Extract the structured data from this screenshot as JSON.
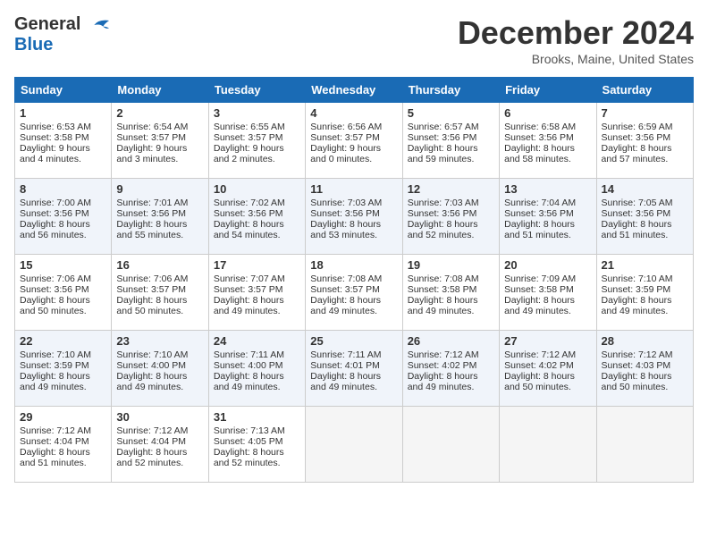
{
  "header": {
    "logo_line1": "General",
    "logo_line2": "Blue",
    "month": "December 2024",
    "location": "Brooks, Maine, United States"
  },
  "weekdays": [
    "Sunday",
    "Monday",
    "Tuesday",
    "Wednesday",
    "Thursday",
    "Friday",
    "Saturday"
  ],
  "weeks": [
    [
      {
        "day": 1,
        "lines": [
          "Sunrise: 6:53 AM",
          "Sunset: 3:58 PM",
          "Daylight: 9 hours",
          "and 4 minutes."
        ]
      },
      {
        "day": 2,
        "lines": [
          "Sunrise: 6:54 AM",
          "Sunset: 3:57 PM",
          "Daylight: 9 hours",
          "and 3 minutes."
        ]
      },
      {
        "day": 3,
        "lines": [
          "Sunrise: 6:55 AM",
          "Sunset: 3:57 PM",
          "Daylight: 9 hours",
          "and 2 minutes."
        ]
      },
      {
        "day": 4,
        "lines": [
          "Sunrise: 6:56 AM",
          "Sunset: 3:57 PM",
          "Daylight: 9 hours",
          "and 0 minutes."
        ]
      },
      {
        "day": 5,
        "lines": [
          "Sunrise: 6:57 AM",
          "Sunset: 3:56 PM",
          "Daylight: 8 hours",
          "and 59 minutes."
        ]
      },
      {
        "day": 6,
        "lines": [
          "Sunrise: 6:58 AM",
          "Sunset: 3:56 PM",
          "Daylight: 8 hours",
          "and 58 minutes."
        ]
      },
      {
        "day": 7,
        "lines": [
          "Sunrise: 6:59 AM",
          "Sunset: 3:56 PM",
          "Daylight: 8 hours",
          "and 57 minutes."
        ]
      }
    ],
    [
      {
        "day": 8,
        "lines": [
          "Sunrise: 7:00 AM",
          "Sunset: 3:56 PM",
          "Daylight: 8 hours",
          "and 56 minutes."
        ]
      },
      {
        "day": 9,
        "lines": [
          "Sunrise: 7:01 AM",
          "Sunset: 3:56 PM",
          "Daylight: 8 hours",
          "and 55 minutes."
        ]
      },
      {
        "day": 10,
        "lines": [
          "Sunrise: 7:02 AM",
          "Sunset: 3:56 PM",
          "Daylight: 8 hours",
          "and 54 minutes."
        ]
      },
      {
        "day": 11,
        "lines": [
          "Sunrise: 7:03 AM",
          "Sunset: 3:56 PM",
          "Daylight: 8 hours",
          "and 53 minutes."
        ]
      },
      {
        "day": 12,
        "lines": [
          "Sunrise: 7:03 AM",
          "Sunset: 3:56 PM",
          "Daylight: 8 hours",
          "and 52 minutes."
        ]
      },
      {
        "day": 13,
        "lines": [
          "Sunrise: 7:04 AM",
          "Sunset: 3:56 PM",
          "Daylight: 8 hours",
          "and 51 minutes."
        ]
      },
      {
        "day": 14,
        "lines": [
          "Sunrise: 7:05 AM",
          "Sunset: 3:56 PM",
          "Daylight: 8 hours",
          "and 51 minutes."
        ]
      }
    ],
    [
      {
        "day": 15,
        "lines": [
          "Sunrise: 7:06 AM",
          "Sunset: 3:56 PM",
          "Daylight: 8 hours",
          "and 50 minutes."
        ]
      },
      {
        "day": 16,
        "lines": [
          "Sunrise: 7:06 AM",
          "Sunset: 3:57 PM",
          "Daylight: 8 hours",
          "and 50 minutes."
        ]
      },
      {
        "day": 17,
        "lines": [
          "Sunrise: 7:07 AM",
          "Sunset: 3:57 PM",
          "Daylight: 8 hours",
          "and 49 minutes."
        ]
      },
      {
        "day": 18,
        "lines": [
          "Sunrise: 7:08 AM",
          "Sunset: 3:57 PM",
          "Daylight: 8 hours",
          "and 49 minutes."
        ]
      },
      {
        "day": 19,
        "lines": [
          "Sunrise: 7:08 AM",
          "Sunset: 3:58 PM",
          "Daylight: 8 hours",
          "and 49 minutes."
        ]
      },
      {
        "day": 20,
        "lines": [
          "Sunrise: 7:09 AM",
          "Sunset: 3:58 PM",
          "Daylight: 8 hours",
          "and 49 minutes."
        ]
      },
      {
        "day": 21,
        "lines": [
          "Sunrise: 7:10 AM",
          "Sunset: 3:59 PM",
          "Daylight: 8 hours",
          "and 49 minutes."
        ]
      }
    ],
    [
      {
        "day": 22,
        "lines": [
          "Sunrise: 7:10 AM",
          "Sunset: 3:59 PM",
          "Daylight: 8 hours",
          "and 49 minutes."
        ]
      },
      {
        "day": 23,
        "lines": [
          "Sunrise: 7:10 AM",
          "Sunset: 4:00 PM",
          "Daylight: 8 hours",
          "and 49 minutes."
        ]
      },
      {
        "day": 24,
        "lines": [
          "Sunrise: 7:11 AM",
          "Sunset: 4:00 PM",
          "Daylight: 8 hours",
          "and 49 minutes."
        ]
      },
      {
        "day": 25,
        "lines": [
          "Sunrise: 7:11 AM",
          "Sunset: 4:01 PM",
          "Daylight: 8 hours",
          "and 49 minutes."
        ]
      },
      {
        "day": 26,
        "lines": [
          "Sunrise: 7:12 AM",
          "Sunset: 4:02 PM",
          "Daylight: 8 hours",
          "and 49 minutes."
        ]
      },
      {
        "day": 27,
        "lines": [
          "Sunrise: 7:12 AM",
          "Sunset: 4:02 PM",
          "Daylight: 8 hours",
          "and 50 minutes."
        ]
      },
      {
        "day": 28,
        "lines": [
          "Sunrise: 7:12 AM",
          "Sunset: 4:03 PM",
          "Daylight: 8 hours",
          "and 50 minutes."
        ]
      }
    ],
    [
      {
        "day": 29,
        "lines": [
          "Sunrise: 7:12 AM",
          "Sunset: 4:04 PM",
          "Daylight: 8 hours",
          "and 51 minutes."
        ]
      },
      {
        "day": 30,
        "lines": [
          "Sunrise: 7:12 AM",
          "Sunset: 4:04 PM",
          "Daylight: 8 hours",
          "and 52 minutes."
        ]
      },
      {
        "day": 31,
        "lines": [
          "Sunrise: 7:13 AM",
          "Sunset: 4:05 PM",
          "Daylight: 8 hours",
          "and 52 minutes."
        ]
      },
      null,
      null,
      null,
      null
    ]
  ]
}
